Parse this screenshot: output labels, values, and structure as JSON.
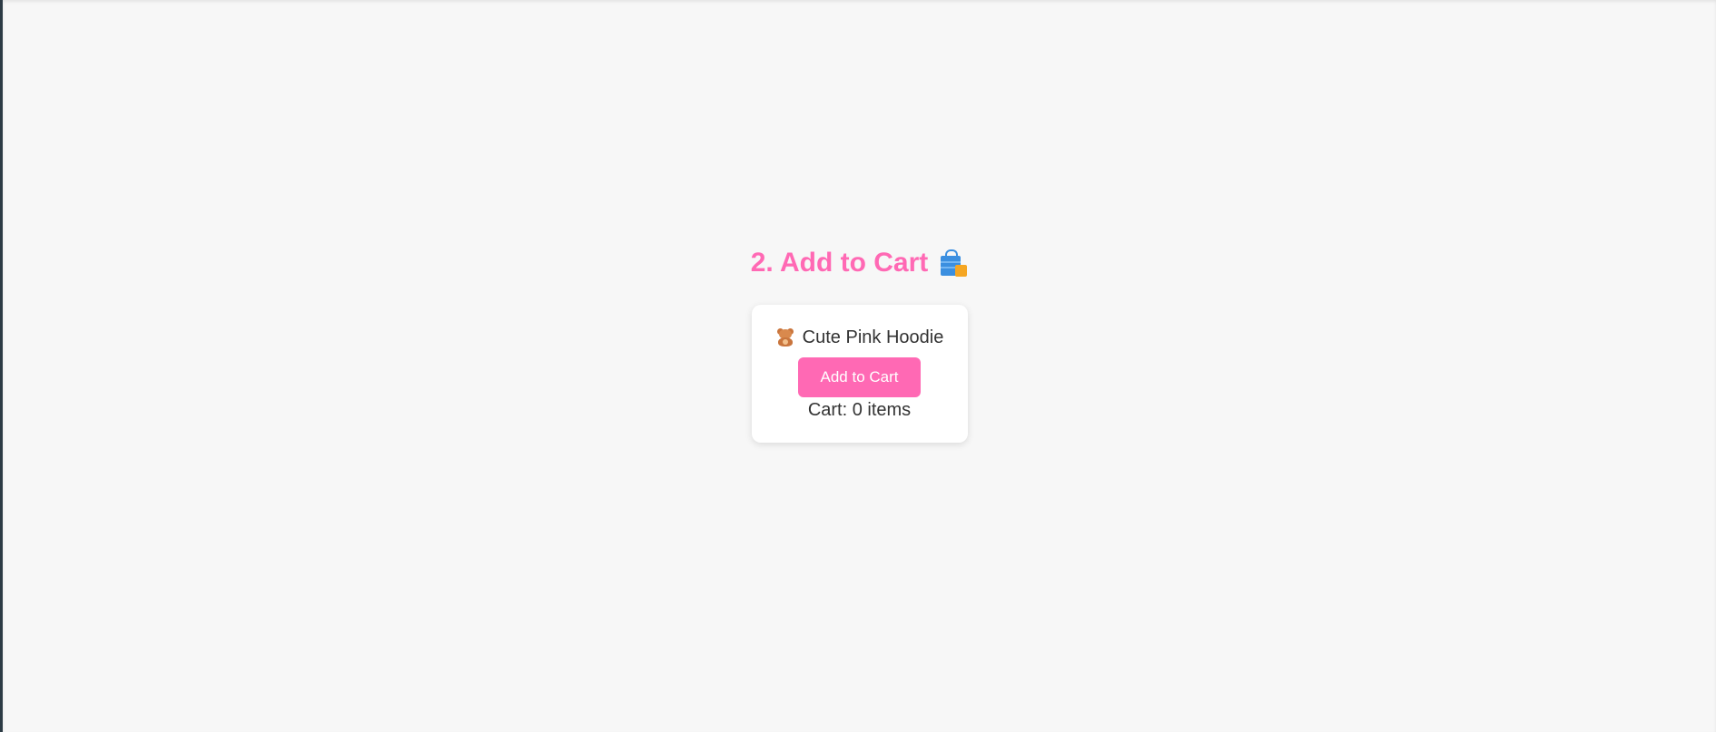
{
  "section": {
    "title": "2. Add to Cart",
    "title_icon": "shopping-bags-icon",
    "accent_color": "#ff69b4"
  },
  "product": {
    "icon": "teddy-bear-icon",
    "name": "Cute Pink Hoodie"
  },
  "actions": {
    "add_to_cart_label": "Add to Cart"
  },
  "cart": {
    "status_text": "Cart: 0 items",
    "count": 0
  }
}
